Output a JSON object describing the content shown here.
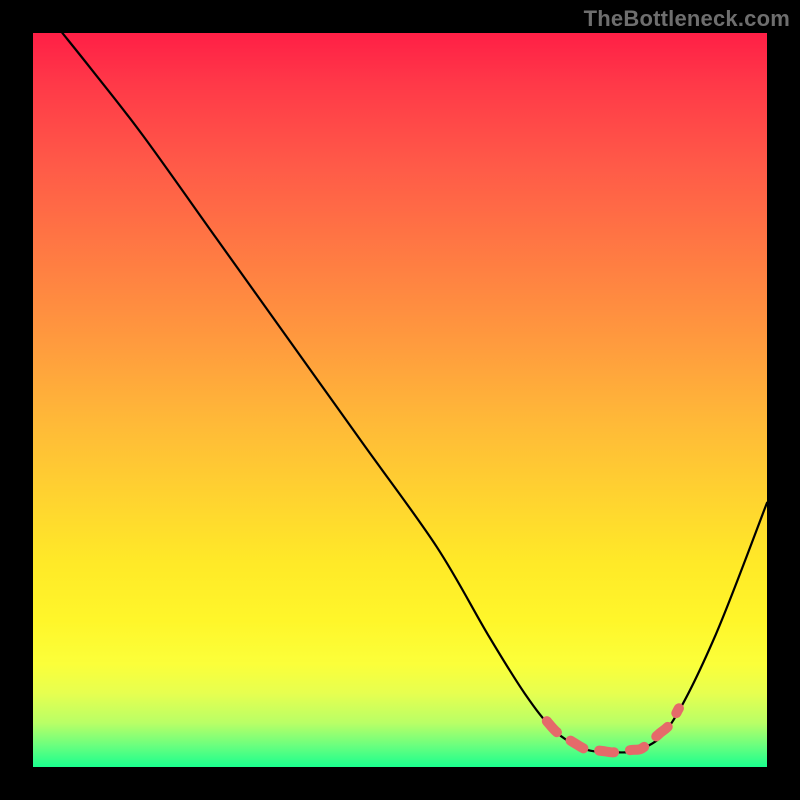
{
  "watermark": "TheBottleneck.com",
  "chart_data": {
    "type": "line",
    "title": "",
    "xlabel": "",
    "ylabel": "",
    "xlim": [
      0,
      100
    ],
    "ylim": [
      0,
      100
    ],
    "grid": false,
    "legend": false,
    "series": [
      {
        "name": "bottleneck-curve",
        "x": [
          4,
          8,
          15,
          25,
          35,
          45,
          55,
          62,
          67,
          71,
          75,
          79,
          83,
          87,
          93,
          100
        ],
        "y": [
          100,
          95,
          86,
          72,
          58,
          44,
          30,
          18,
          10,
          5,
          2.5,
          2,
          2.5,
          6,
          18,
          36
        ]
      }
    ],
    "annotations": [
      {
        "name": "optimal-range",
        "style": "dashed-highlight",
        "color": "#e56a6a",
        "x_start": 70,
        "x_end": 88
      }
    ],
    "background": {
      "type": "vertical-gradient",
      "stops": [
        {
          "pos": 0.0,
          "color": "#ff1f46"
        },
        {
          "pos": 0.5,
          "color": "#ffb938"
        },
        {
          "pos": 0.8,
          "color": "#fff62a"
        },
        {
          "pos": 1.0,
          "color": "#1aff8e"
        }
      ]
    }
  }
}
